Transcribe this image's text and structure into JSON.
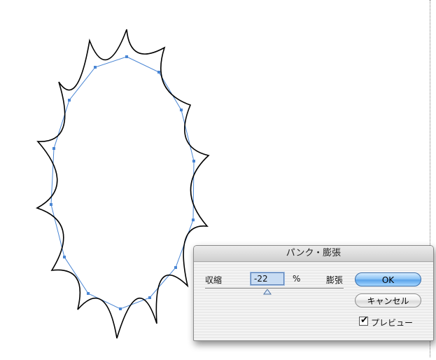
{
  "dialog": {
    "title": "パンク・膨張",
    "shrink_label": "収縮",
    "expand_label": "膨張",
    "amount_value": "-22",
    "percent_sign": "%",
    "slider_value_percent": -22,
    "ok_label": "OK",
    "cancel_label": "キャンセル",
    "preview_label": "プレビュー",
    "preview_checked": true
  },
  "colors": {
    "path_stroke": "#000000",
    "selection_blue": "#4a86d4",
    "ok_button": "#6aaef0",
    "field_highlight": "#c8dcf3"
  },
  "icons": {
    "preview_check": "check-mark-icon",
    "slider_thumb": "triangle-thumb-icon"
  }
}
